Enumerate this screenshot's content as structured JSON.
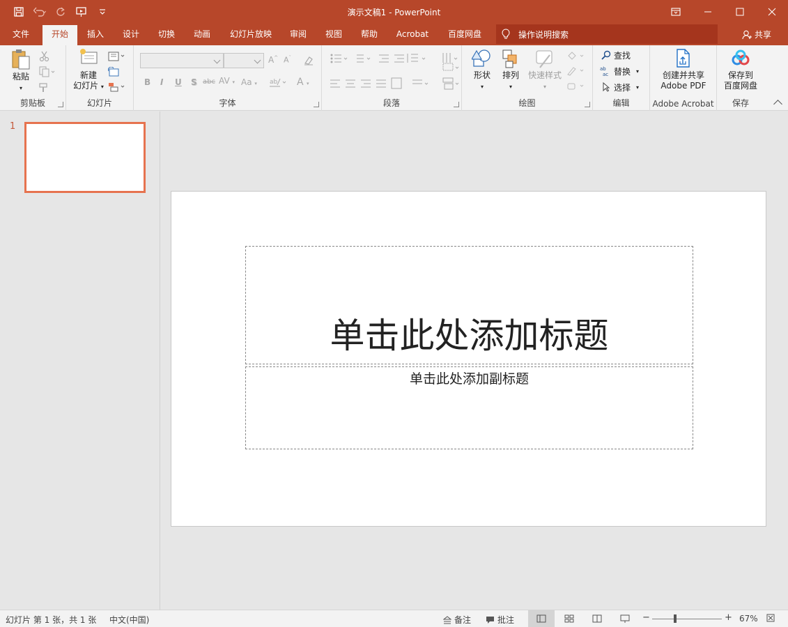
{
  "window": {
    "title": "演示文稿1  -  PowerPoint",
    "share_label": "共享"
  },
  "tabs": [
    "文件",
    "开始",
    "插入",
    "设计",
    "切换",
    "动画",
    "幻灯片放映",
    "审阅",
    "视图",
    "帮助",
    "Acrobat",
    "百度网盘"
  ],
  "active_tab": "开始",
  "tell_me": "操作说明搜索",
  "ribbon": {
    "clipboard": {
      "paste": "粘贴",
      "label": "剪贴板"
    },
    "slides": {
      "new_slide_line1": "新建",
      "new_slide_line2": "幻灯片",
      "label": "幻灯片"
    },
    "font": {
      "label": "字体",
      "bold": "B",
      "italic": "I",
      "underline": "U",
      "shadow": "S",
      "strike": "abc",
      "spacing": "AV",
      "case": "Aa",
      "color": "A"
    },
    "paragraph": {
      "label": "段落"
    },
    "drawing": {
      "shapes": "形状",
      "arrange": "排列",
      "quick_styles": "快速样式",
      "label": "绘图"
    },
    "editing": {
      "find": "查找",
      "replace": "替换",
      "select": "选择",
      "label": "编辑"
    },
    "acrobat": {
      "create_line1": "创建并共享",
      "create_line2": "Adobe PDF",
      "label": "Adobe Acrobat"
    },
    "save": {
      "line1": "保存到",
      "line2": "百度网盘",
      "label": "保存"
    }
  },
  "thumbnails": [
    {
      "number": "1"
    }
  ],
  "slide": {
    "title_placeholder": "单击此处添加标题",
    "subtitle_placeholder": "单击此处添加副标题"
  },
  "statusbar": {
    "slide_info": "幻灯片 第 1 张，共 1 张",
    "language": "中文(中国)",
    "notes": "备注",
    "comments": "批注",
    "zoom": "67%",
    "zoom_minus": "−",
    "zoom_plus": "+"
  },
  "colors": {
    "accent": "#b7472a",
    "tellme_bg": "#a5351d",
    "ribbon_bg": "#f3f3f3",
    "thumb_border": "#e6734f"
  }
}
